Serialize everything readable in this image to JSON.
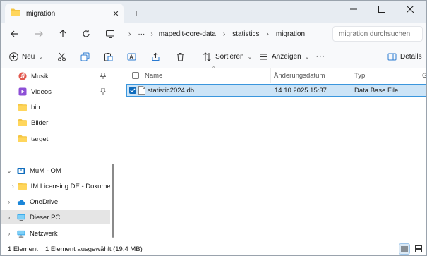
{
  "tab": {
    "title": "migration",
    "close": "✕",
    "new_tab": "+"
  },
  "window_controls": {
    "minimize": "—",
    "maximize": "☐",
    "close": "✕"
  },
  "address": {
    "overflow": "···",
    "crumbs": [
      "mapedit-core-data",
      "statistics",
      "migration"
    ],
    "separator": "›"
  },
  "search": {
    "placeholder": "migration durchsuchen"
  },
  "toolbar": {
    "new_label": "Neu",
    "sort_label": "Sortieren",
    "view_label": "Anzeigen",
    "more_label": "···",
    "details_label": "Details"
  },
  "sidebar": {
    "quick_access": [
      {
        "label": "Musik",
        "icon": "music-icon",
        "pinned": true
      },
      {
        "label": "Videos",
        "icon": "video-icon",
        "pinned": true
      },
      {
        "label": "bin",
        "icon": "folder-icon",
        "pinned": false
      },
      {
        "label": "Bilder",
        "icon": "folder-icon",
        "pinned": false
      },
      {
        "label": "target",
        "icon": "folder-icon",
        "pinned": false
      }
    ],
    "tree": [
      {
        "label": "MuM - OM",
        "icon": "cloud-org-icon",
        "expanded": true
      },
      {
        "label": "IM Licensing DE - Dokumente",
        "icon": "folder-icon",
        "expanded": false
      },
      {
        "label": "OneDrive",
        "icon": "onedrive-icon",
        "expanded": false
      },
      {
        "label": "Dieser PC",
        "icon": "pc-icon",
        "expanded": false,
        "selected": true
      },
      {
        "label": "Netzwerk",
        "icon": "network-icon",
        "expanded": false
      }
    ]
  },
  "columns": [
    "Name",
    "Änderungsdatum",
    "Typ",
    "Gr"
  ],
  "files": [
    {
      "name": "statistic2024.db",
      "modified": "14.10.2025 15:37",
      "type": "Data Base File",
      "selected": true
    }
  ],
  "status": {
    "count": "1 Element",
    "selection": "1 Element ausgewählt (19,4 MB)"
  },
  "colors": {
    "accent": "#0f6cbd",
    "selection_bg": "#cce4f7",
    "folder": "#f4c542"
  }
}
